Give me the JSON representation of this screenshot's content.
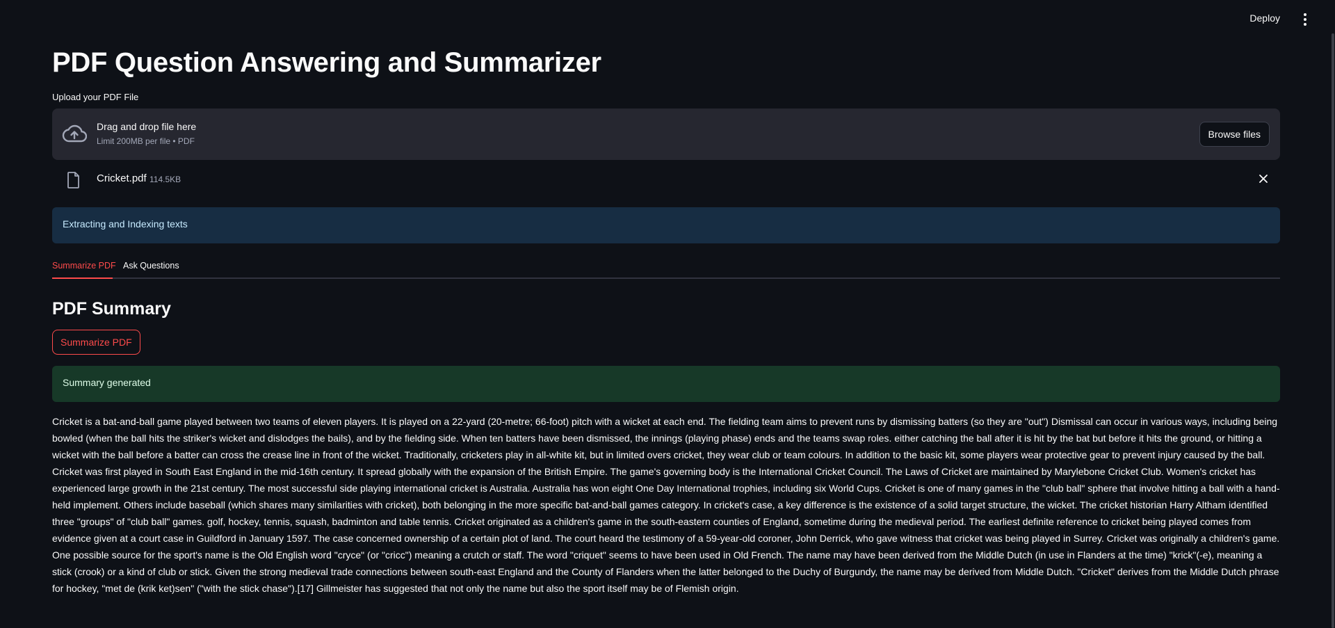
{
  "header": {
    "deploy_label": "Deploy",
    "menu_icon": "kebab-menu-icon"
  },
  "main": {
    "title": "PDF Question Answering and Summarizer",
    "upload": {
      "label": "Upload your PDF File",
      "dropzone_title": "Drag and drop file here",
      "dropzone_sub": "Limit 200MB per file • PDF",
      "browse_label": "Browse files",
      "icon": "cloud-upload-icon"
    },
    "file": {
      "name": "Cricket.pdf",
      "size": "114.5KB",
      "icon": "file-icon"
    },
    "info_message": "Extracting and Indexing texts",
    "tabs": [
      {
        "label": "Summarize PDF",
        "active": true
      },
      {
        "label": "Ask Questions",
        "active": false
      }
    ],
    "section_title": "PDF Summary",
    "summarize_button": "Summarize PDF",
    "success_message": "Summary generated",
    "summary": "Cricket is a bat-and-ball game played between two teams of eleven players. It is played on a 22-yard (20-metre; 66-foot) pitch with a wicket at each end. The fielding team aims to prevent runs by dismissing batters (so they are \"out\") Dismissal can occur in various ways, including being bowled (when the ball hits the striker's wicket and dislodges the bails), and by the fielding side. When ten batters have been dismissed, the innings (playing phase) ends and the teams swap roles. either catching the ball after it is hit by the bat but before it hits the ground, or hitting a wicket with the ball before a batter can cross the crease line in front of the wicket. Traditionally, cricketers play in all-white kit, but in limited overs cricket, they wear club or team colours. In addition to the basic kit, some players wear protective gear to prevent injury caused by the ball. Cricket was first played in South East England in the mid-16th century. It spread globally with the expansion of the British Empire. The game's governing body is the International Cricket Council. The Laws of Cricket are maintained by Marylebone Cricket Club. Women's cricket has experienced large growth in the 21st century. The most successful side playing international cricket is Australia. Australia has won eight One Day International trophies, including six World Cups. Cricket is one of many games in the \"club ball\" sphere that involve hitting a ball with a hand-held implement. Others include baseball (which shares many similarities with cricket), both belonging in the more specific bat-and-ball games category. In cricket's case, a key difference is the existence of a solid target structure, the wicket. The cricket historian Harry Altham identified three \"groups\" of \"club ball\" games. golf, hockey, tennis, squash, badminton and table tennis. Cricket originated as a children's game in the south-eastern counties of England, sometime during the medieval period. The earliest definite reference to cricket being played comes from evidence given at a court case in Guildford in January 1597. The case concerned ownership of a certain plot of land. The court heard the testimony of a 59-year-old coroner, John Derrick, who gave witness that cricket was being played in Surrey. Cricket was originally a children's game. One possible source for the sport's name is the Old English word \"cryce\" (or \"cricc\") meaning a crutch or staff. The word \"criquet\" seems to have been used in Old French. The name may have been derived from the Middle Dutch (in use in Flanders at the time) \"krick\"(-e), meaning a stick (crook) or a kind of club or stick. Given the strong medieval trade connections between south-east England and the County of Flanders when the latter belonged to the Duchy of Burgundy, the name may be derived from Middle Dutch. \"Cricket\" derives from the Middle Dutch phrase for hockey, \"met de (krik ket)sen\" (\"with the stick chase\").[17] Gillmeister has suggested that not only the name but also the sport itself may be of Flemish origin."
  },
  "colors": {
    "background": "#0e1117",
    "accent": "#ff4b4b",
    "info_bg": "#172d43",
    "success_bg": "#173928"
  }
}
